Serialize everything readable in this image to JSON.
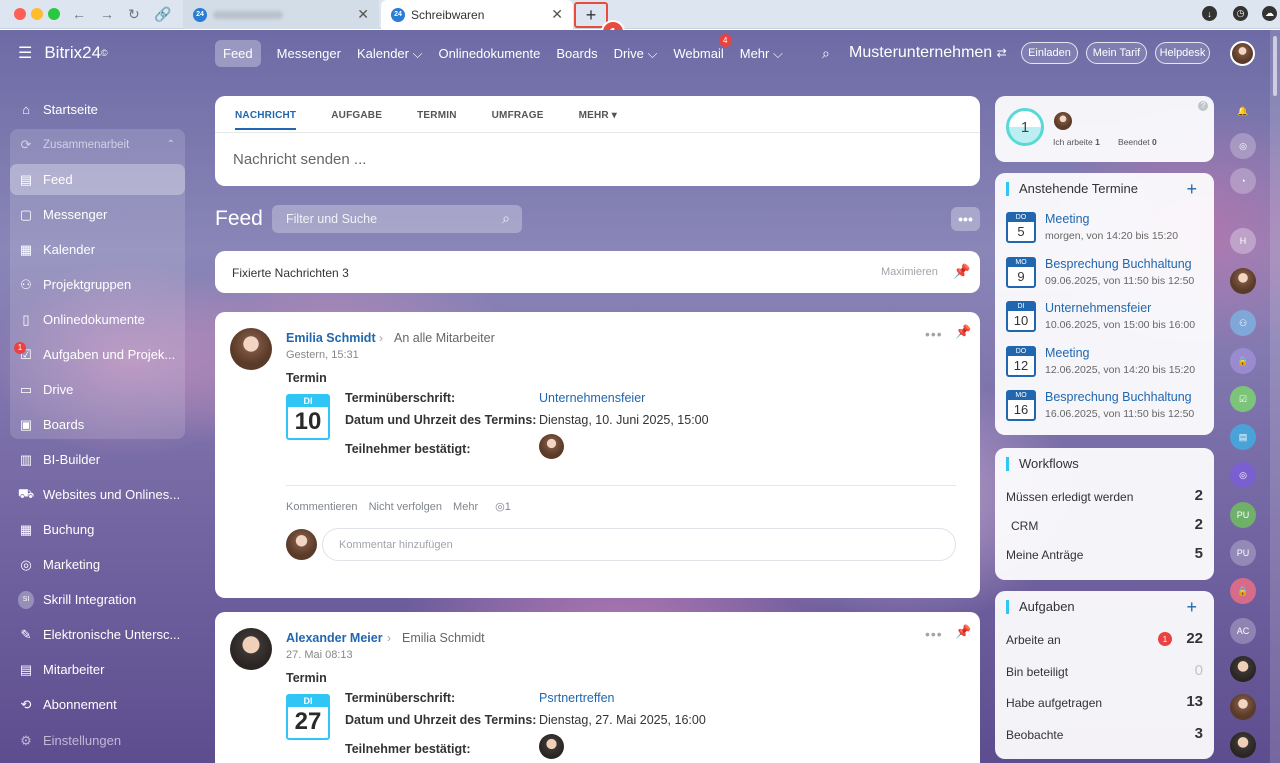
{
  "browser": {
    "tab1": {
      "title": "Yan s Jessen",
      "favicon": "24"
    },
    "tab2": {
      "title": "Schreibwaren",
      "favicon": "24"
    },
    "newtab": "+",
    "callout_number": "1"
  },
  "sidebar": {
    "logo": "Bitrix24",
    "logo_mark": "©",
    "items": [
      {
        "label": "Startseite",
        "icon": "home-icon"
      },
      {
        "label": "Zusammenarbeit",
        "icon": "collab-icon"
      },
      {
        "label": "Feed",
        "icon": "feed-icon"
      },
      {
        "label": "Messenger",
        "icon": "chat-icon"
      },
      {
        "label": "Kalender",
        "icon": "calendar-icon"
      },
      {
        "label": "Projektgruppen",
        "icon": "group-icon"
      },
      {
        "label": "Onlinedokumente",
        "icon": "document-icon"
      },
      {
        "label": "Aufgaben und Projek...",
        "icon": "tasks-icon",
        "badge": "1"
      },
      {
        "label": "Drive",
        "icon": "drive-icon"
      },
      {
        "label": "Boards",
        "icon": "boards-icon"
      },
      {
        "label": "BI-Builder",
        "icon": "chart-icon"
      },
      {
        "label": "Websites und Onlines...",
        "icon": "cart-icon"
      },
      {
        "label": "Buchung",
        "icon": "booking-icon"
      },
      {
        "label": "Marketing",
        "icon": "target-icon"
      },
      {
        "label": "Skrill Integration",
        "icon": "si-icon",
        "initials": "SI"
      },
      {
        "label": "Elektronische Untersc...",
        "icon": "sign-icon"
      },
      {
        "label": "Mitarbeiter",
        "icon": "employees-icon"
      },
      {
        "label": "Abonnement",
        "icon": "subscription-icon"
      },
      {
        "label": "Einstellungen",
        "icon": "gear-icon"
      }
    ]
  },
  "topnav": {
    "items": [
      "Feed",
      "Messenger",
      "Kalender ⌵",
      "Onlinedokumente",
      "Boards",
      "Drive ⌵",
      "Webmail",
      "Mehr ⌵"
    ],
    "webmail_badge": "4",
    "company": "Musterunternehmen",
    "einladen": "Einladen",
    "tarif": "Mein Tarif",
    "helpdesk": "Helpdesk"
  },
  "composer": {
    "tabs": [
      "NACHRICHT",
      "AUFGABE",
      "TERMIN",
      "UMFRAGE",
      "MEHR ▾"
    ],
    "placeholder": "Nachricht senden ..."
  },
  "feed": {
    "title": "Feed",
    "filter_placeholder": "Filter und Suche",
    "fixed_label": "Fixierte Nachrichten",
    "fixed_count": "3",
    "maximize": "Maximieren"
  },
  "posts": [
    {
      "author": "Emilia Schmidt",
      "recipient": "An alle Mitarbeiter",
      "date": "Gestern, 15:31",
      "type": "Termin",
      "cal_day": "DI",
      "cal_num": "10",
      "label_title": "Terminüberschrift:",
      "value_title": "Unternehmensfeier",
      "label_datetime": "Datum und Uhrzeit des Termins:",
      "value_datetime": "Dienstag, 10. Juni 2025, 15:00",
      "label_participants": "Teilnehmer bestätigt:",
      "actions": [
        "Kommentieren",
        "Nicht verfolgen",
        "Mehr"
      ],
      "views": "◎1",
      "comment_placeholder": "Kommentar hinzufügen"
    },
    {
      "author": "Alexander Meier",
      "recipient": "Emilia Schmidt",
      "date": "27. Mai 08:13",
      "type": "Termin",
      "cal_day": "DI",
      "cal_num": "27",
      "label_title": "Terminüberschrift:",
      "value_title": "Psrtnertreffen",
      "label_datetime": "Datum und Uhrzeit des Termins:",
      "value_datetime": "Dienstag, 27. Mai 2025, 16:00",
      "label_participants": "Teilnehmer bestätigt:"
    }
  ],
  "timer": {
    "count": "1",
    "working_label": "Ich arbeite",
    "working_count": "1",
    "done_label": "Beendet",
    "done_count": "0"
  },
  "events": {
    "title": "Anstehende Termine",
    "items": [
      {
        "day": "DO",
        "num": "5",
        "title": "Meeting",
        "time": "morgen, von 14:20 bis 15:20"
      },
      {
        "day": "MO",
        "num": "9",
        "title": "Besprechung Buchhaltung",
        "time": "09.06.2025, von 11:50 bis 12:50"
      },
      {
        "day": "DI",
        "num": "10",
        "title": "Unternehmensfeier",
        "time": "10.06.2025, von 15:00 bis 16:00"
      },
      {
        "day": "DO",
        "num": "12",
        "title": "Meeting",
        "time": "12.06.2025, von 14:20 bis 15:20"
      },
      {
        "day": "MO",
        "num": "16",
        "title": "Besprechung Buchhaltung",
        "time": "16.06.2025, von 11:50 bis 12:50"
      }
    ]
  },
  "workflows": {
    "title": "Workflows",
    "rows": [
      {
        "label": "Müssen erledigt werden",
        "value": "2"
      },
      {
        "label": "CRM",
        "value": "2"
      },
      {
        "label": "Meine Anträge",
        "value": "5"
      }
    ]
  },
  "tasks": {
    "title": "Aufgaben",
    "rows": [
      {
        "label": "Arbeite an",
        "value": "22",
        "badge": "1"
      },
      {
        "label": "Bin beteiligt",
        "value": "0"
      },
      {
        "label": "Habe aufgetragen",
        "value": "13"
      },
      {
        "label": "Beobachte",
        "value": "3"
      }
    ]
  },
  "rightbar": [
    "bell-icon",
    "pulse-icon",
    "chat-bubble-icon",
    "H",
    "user-avatar",
    "team-icon",
    "lock-icon",
    "check-icon",
    "message-icon",
    "spiral-icon",
    "PU",
    "PU",
    "lock-icon",
    "AC",
    "user-avatar",
    "user-avatar",
    "user-avatar"
  ]
}
